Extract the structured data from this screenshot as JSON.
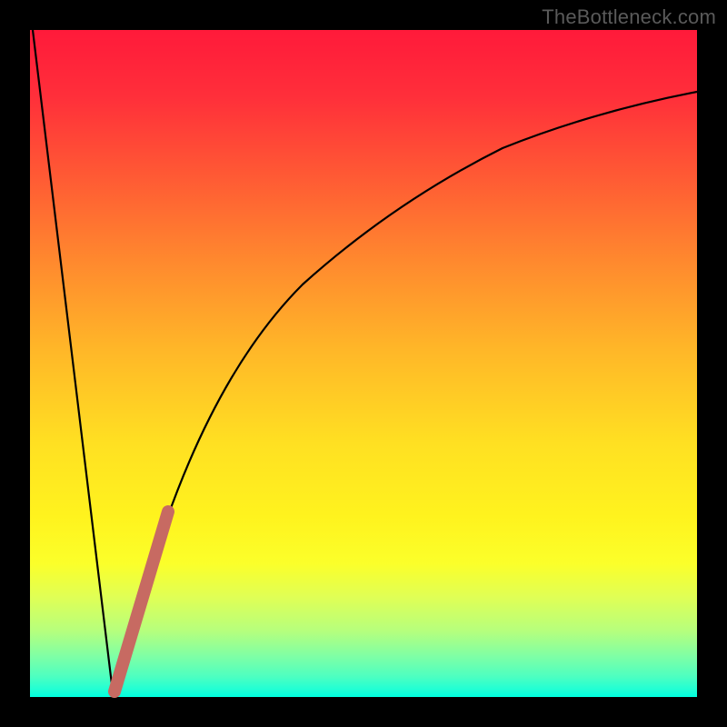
{
  "watermark": "TheBottleneck.com",
  "colors": {
    "frame": "#000000",
    "curve": "#000000",
    "highlight": "#c76a62",
    "gradient_top": "#ff1a3a",
    "gradient_bottom": "#00ffdf"
  },
  "chart_data": {
    "type": "line",
    "title": "",
    "xlabel": "",
    "ylabel": "",
    "xlim": [
      0,
      100
    ],
    "ylim": [
      0,
      100
    ],
    "grid": false,
    "legend": false,
    "series": [
      {
        "name": "bottleneck-curve",
        "x": [
          0,
          2,
          4,
          6,
          8,
          10,
          11,
          12,
          13,
          14,
          15,
          17,
          20,
          24,
          28,
          32,
          36,
          40,
          45,
          50,
          55,
          60,
          65,
          70,
          75,
          80,
          85,
          90,
          95,
          100
        ],
        "values": [
          100,
          83,
          66,
          50,
          33,
          17,
          8,
          1,
          0.5,
          1,
          5,
          14,
          26,
          39,
          49,
          57,
          63,
          68,
          73,
          77,
          80,
          82.5,
          84.5,
          86,
          87.3,
          88.3,
          89.1,
          89.8,
          90.3,
          90.7
        ]
      },
      {
        "name": "highlight-segment",
        "x": [
          12.5,
          20.5
        ],
        "values": [
          0.5,
          28
        ]
      }
    ],
    "annotations": []
  }
}
